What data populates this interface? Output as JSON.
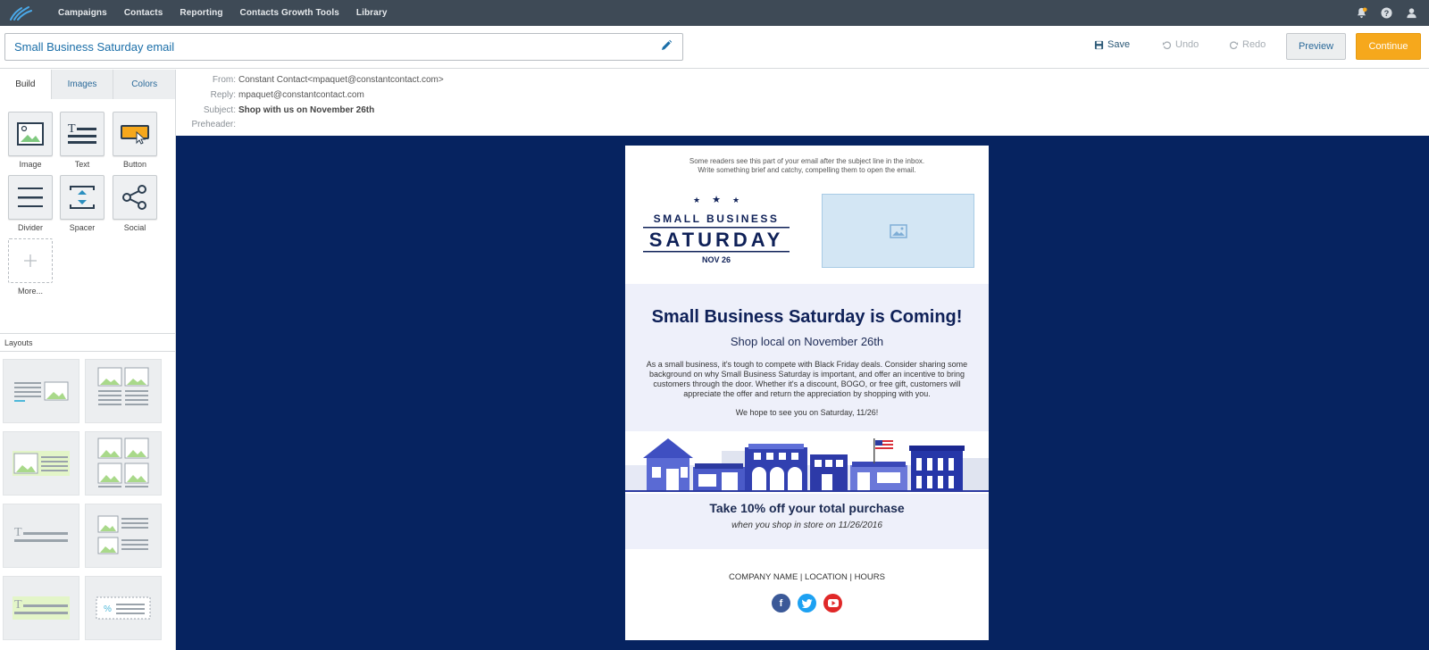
{
  "nav": {
    "items": [
      "Campaigns",
      "Contacts",
      "Reporting",
      "Contacts Growth Tools",
      "Library"
    ],
    "icons": [
      "bell-icon",
      "help-icon",
      "user-icon"
    ]
  },
  "titlebar": {
    "email_name": "Small Business Saturday email",
    "save_label": "Save",
    "undo_label": "Undo",
    "redo_label": "Redo",
    "preview_label": "Preview",
    "continue_label": "Continue"
  },
  "sidebar": {
    "tabs": [
      "Build",
      "Images",
      "Colors"
    ],
    "tools": [
      {
        "label": "Image",
        "icon": "image-icon"
      },
      {
        "label": "Text",
        "icon": "text-icon"
      },
      {
        "label": "Button",
        "icon": "button-icon"
      },
      {
        "label": "Divider",
        "icon": "divider-icon"
      },
      {
        "label": "Spacer",
        "icon": "spacer-icon"
      },
      {
        "label": "Social",
        "icon": "social-share-icon"
      },
      {
        "label": "More...",
        "icon": "plus-icon"
      }
    ],
    "layouts_label": "Layouts"
  },
  "header": {
    "from_label": "From:",
    "from_value": "Constant Contact<mpaquet@constantcontact.com>",
    "reply_label": "Reply:",
    "reply_value": "mpaquet@constantcontact.com",
    "subject_label": "Subject:",
    "subject_value": "Shop with us on November 26th",
    "preheader_label": "Preheader:"
  },
  "email": {
    "preheader_line1": "Some readers see this part of your email after the subject line in the inbox.",
    "preheader_line2": "Write something brief and catchy, compelling them to open the email.",
    "logo": {
      "line1": "SMALL BUSINESS",
      "line2": "SATURDAY",
      "line3": "NOV 26"
    },
    "title": "Small Business Saturday is Coming!",
    "subtitle": "Shop local on November 26th",
    "body": "As a small business, it's tough to compete with Black Friday deals. Consider sharing some background on why Small Business Saturday is important, and offer an incentive to bring customers through the door. Whether it's a discount, BOGO, or free gift, customers will appreciate the offer and return the appreciation by shopping with you.",
    "body2": "We hope to see you on Saturday, 11/26!",
    "offer_title": "Take 10% off your total purchase",
    "offer_sub": "when you shop in store on 11/26/2016",
    "footer": "COMPANY NAME | LOCATION | HOURS",
    "social": [
      "facebook-icon",
      "twitter-icon",
      "youtube-icon"
    ]
  },
  "colors": {
    "nav_bg": "#3e4a56",
    "canvas_bg": "#062360",
    "accent_orange": "#f6a81c",
    "brand_navy": "#0f2158"
  }
}
